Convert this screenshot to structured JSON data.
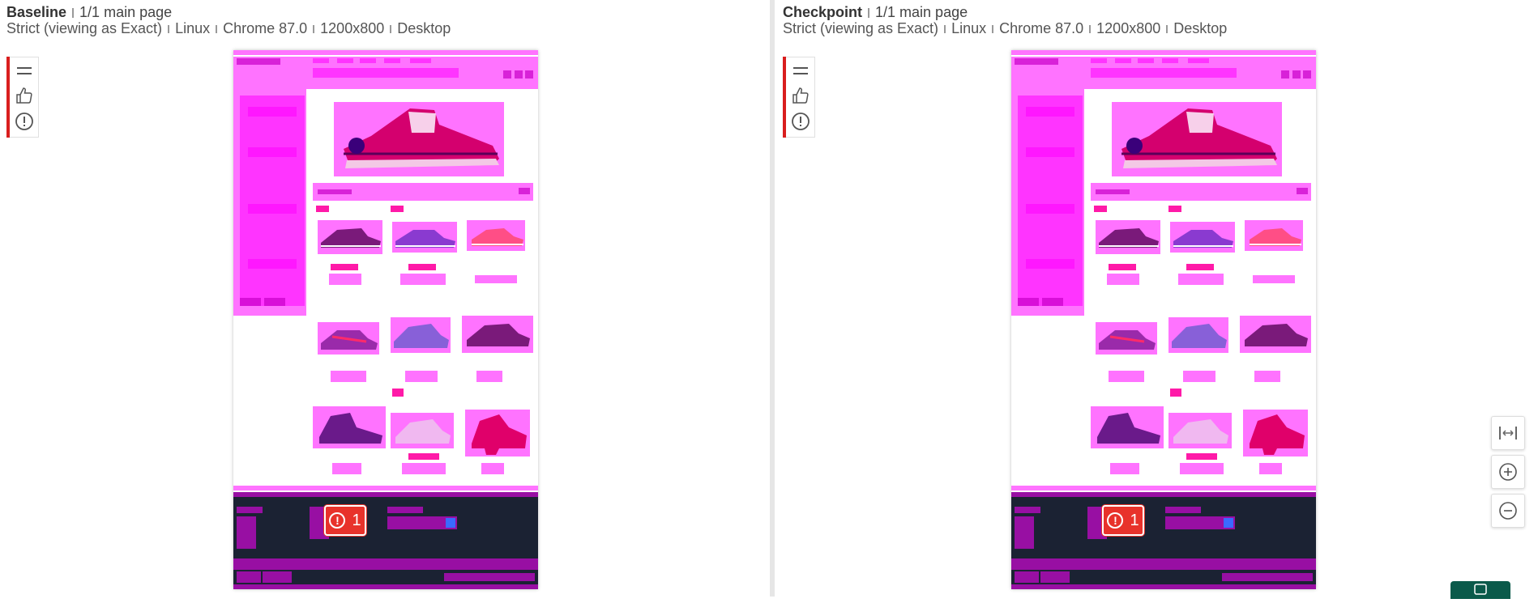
{
  "baseline": {
    "title": "Baseline",
    "page_info": "1/1 main page",
    "meta": [
      "Strict (viewing as Exact)",
      "Linux",
      "Chrome 87.0",
      "1200x800",
      "Desktop"
    ],
    "diff_count": "1"
  },
  "checkpoint": {
    "title": "Checkpoint",
    "page_info": "1/1 main page",
    "meta": [
      "Strict (viewing as Exact)",
      "Linux",
      "Chrome 87.0",
      "1200x800",
      "Desktop"
    ],
    "diff_count": "1"
  },
  "toolbar": {
    "icons": [
      "menu-icon",
      "thumbs-up-icon",
      "exclamation-icon"
    ]
  },
  "zoom_controls": {
    "icons": [
      "fit-width-icon",
      "zoom-in-icon",
      "zoom-out-icon"
    ]
  },
  "colors": {
    "diff_highlight": "#ff00ff",
    "error_badge": "#e8322b",
    "footer_bg": "#1b2233",
    "rail_accent": "#d91e1e",
    "chat_button": "#0a5a4a"
  }
}
